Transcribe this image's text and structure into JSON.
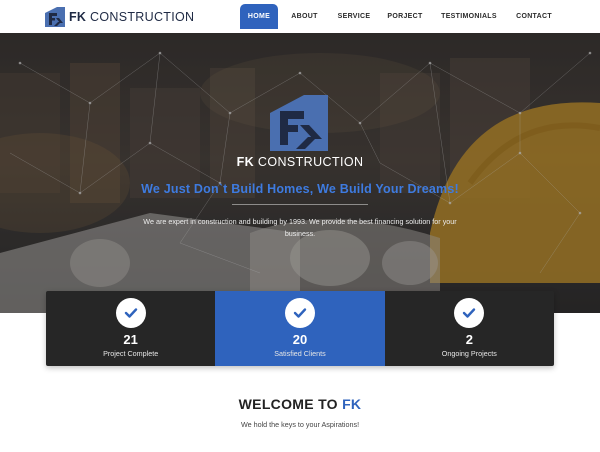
{
  "brand": {
    "initials": "FK",
    "name": "CONSTRUCTION"
  },
  "nav": [
    {
      "label": "HOME",
      "active": true
    },
    {
      "label": "ABOUT",
      "active": false
    },
    {
      "label": "SERVICE",
      "active": false
    },
    {
      "label": "PORJECT",
      "active": false
    },
    {
      "label": "TESTIMONIALS",
      "active": false
    },
    {
      "label": "CONTACT",
      "active": false
    }
  ],
  "hero": {
    "brand_initials": "FK",
    "brand_name": "CONSTRUCTION",
    "tagline": "We Just Don`t Build Homes, We Build Your Dreams!",
    "description": "We are expert in construction and building by 1993. We provide the best financing solution for your business."
  },
  "stats": [
    {
      "number": "21",
      "label": "Project Complete",
      "icon": "check-icon",
      "highlight": false
    },
    {
      "number": "20",
      "label": "Satisfied Clients",
      "icon": "check-icon",
      "highlight": true
    },
    {
      "number": "2",
      "label": "Ongoing Projects",
      "icon": "check-icon",
      "highlight": false
    }
  ],
  "welcome": {
    "title_prefix": "WELCOME TO",
    "title_accent": "FK",
    "subtitle": "We hold the keys to your Aspirations!"
  },
  "colors": {
    "accent": "#2f63bd",
    "tagline": "#3e7be0",
    "stat_dark": "#262626",
    "logo_navy": "#1f2a44",
    "logo_blue": "#4a6fb0"
  }
}
